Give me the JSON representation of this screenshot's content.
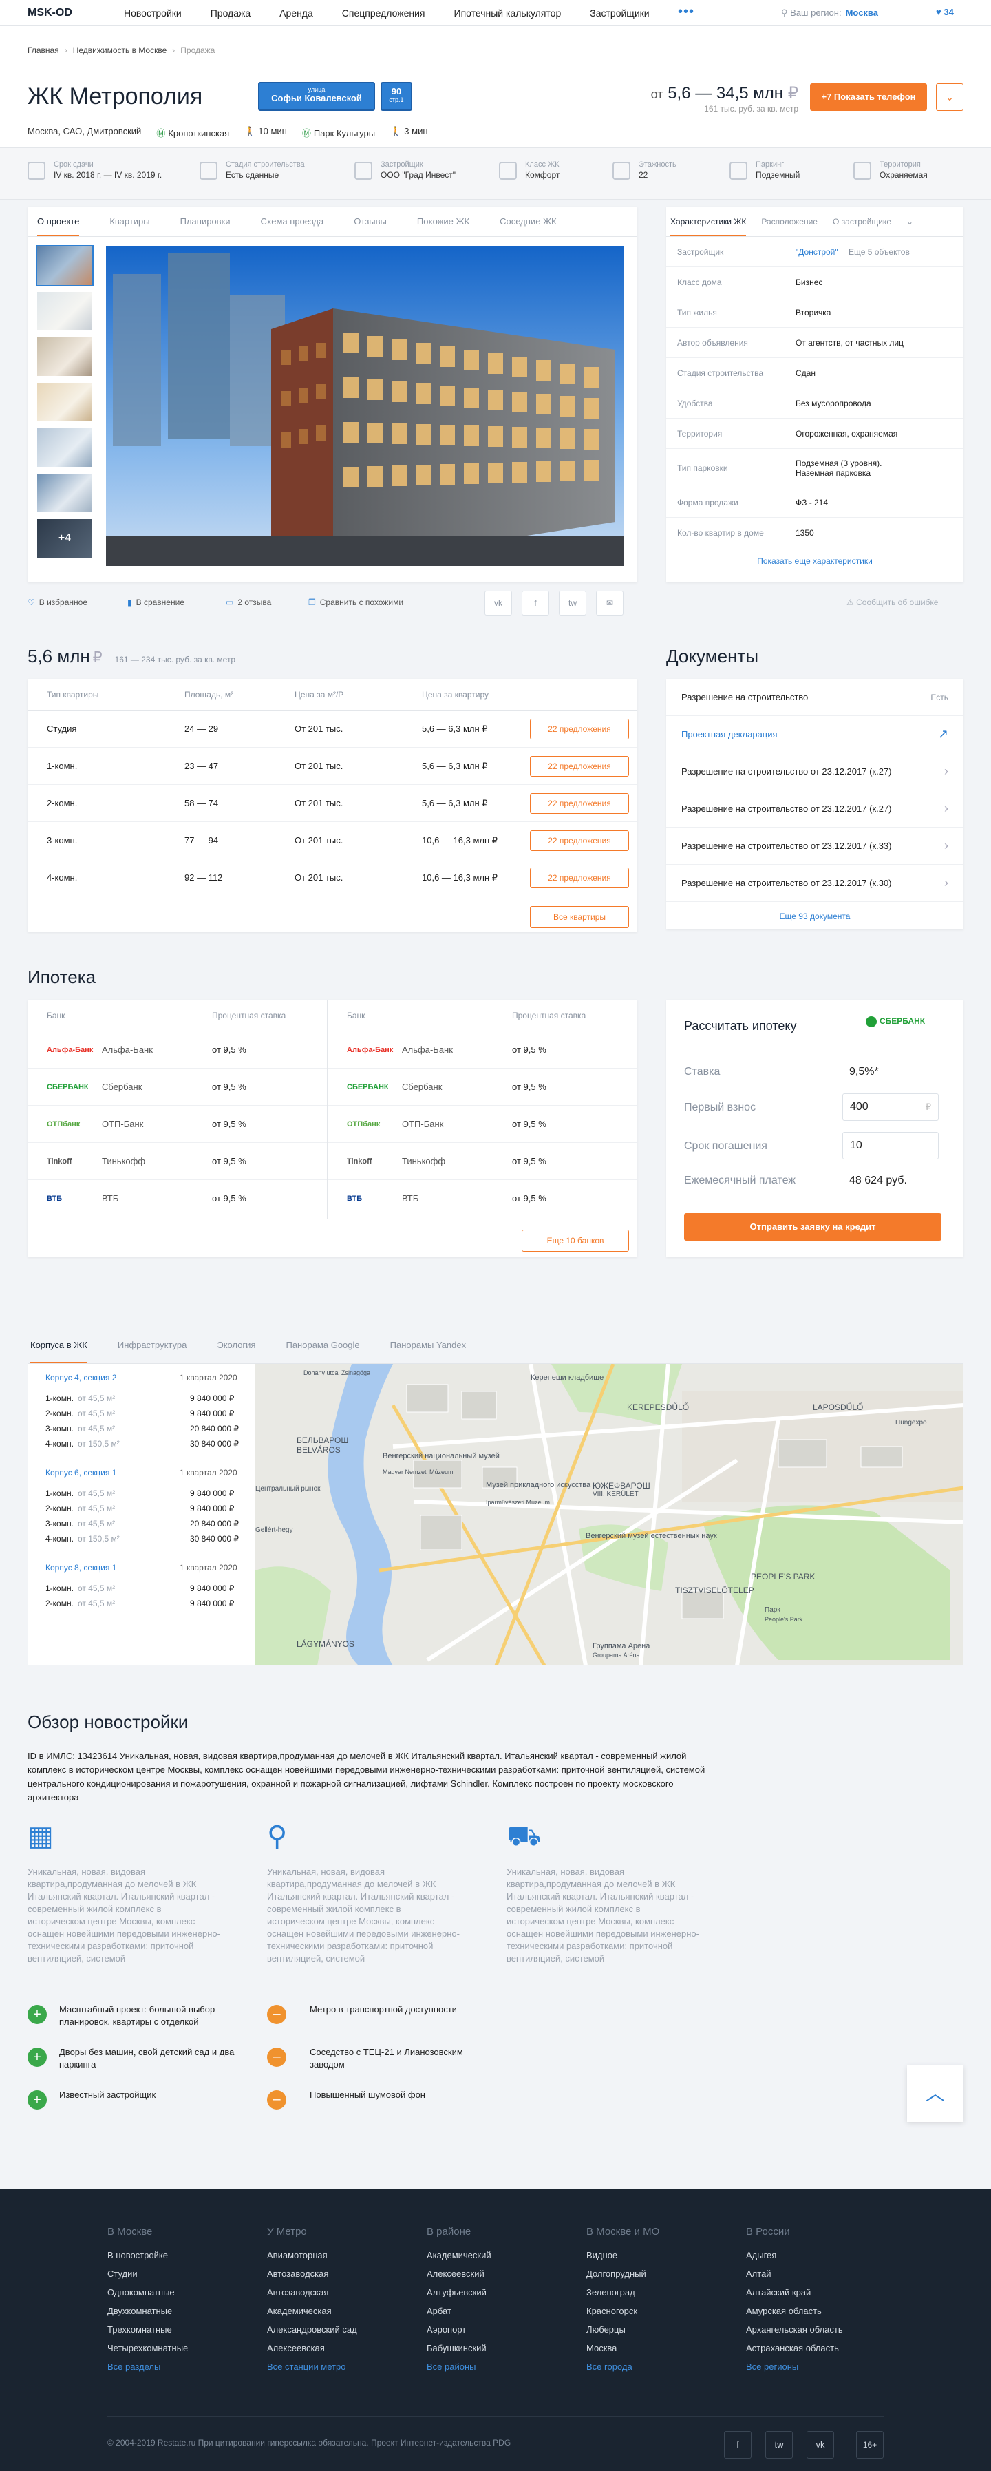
{
  "topbar": {
    "logo": "MSK-OD",
    "nav": [
      "Новостройки",
      "Продажа",
      "Аренда",
      "Спецпредложения",
      "Ипотечный калькулятор",
      "Застройщики"
    ],
    "more": "•••",
    "region_label": "Ваш регион:",
    "region_value": "Москва",
    "favorites_count": "34"
  },
  "breadcrumb": {
    "items": [
      "Главная",
      "Недвижимость в Москве",
      "Продажа"
    ]
  },
  "complex": {
    "title": "ЖК Метрополия",
    "street_label": "улица",
    "street_name": "Софьи Ковалевской",
    "house_number": "90",
    "house_building": "стр.1",
    "address": "Москва, САО, Дмитровский",
    "metro": [
      {
        "name": "Кропоткинская",
        "color": "#2b9a45"
      },
      {
        "name": "10 мин",
        "color": "#8a93a0"
      },
      {
        "name": "Парк Культуры",
        "color": "#2b9a45"
      },
      {
        "name": "3 мин",
        "color": "#8a93a0"
      }
    ],
    "price_prefix": "от",
    "price_range": "5,6 — 34,5 млн",
    "currency": "₽",
    "price_per_meter": "161 тыс. руб. за кв. метр",
    "show_phone_label": "+7 Показать телефон",
    "more_label": "⌄"
  },
  "specs": [
    {
      "label": "Срок сдачи",
      "value": "IV кв. 2018 г. — IV кв. 2019 г."
    },
    {
      "label": "Стадия строительства",
      "value": "Есть сданные"
    },
    {
      "label": "Застройщик",
      "value": "ООО \"Град Инвест\""
    },
    {
      "label": "Класс ЖК",
      "value": "Комфорт"
    },
    {
      "label": "Этажность",
      "value": "22"
    },
    {
      "label": "Паркинг",
      "value": "Подземный"
    },
    {
      "label": "Территория",
      "value": "Охраняемая"
    }
  ],
  "main_tabs": [
    "О проекте",
    "Квартиры",
    "Планировки",
    "Схема проезда",
    "Отзывы",
    "Похожие ЖК",
    "Соседние ЖК"
  ],
  "gallery": {
    "more_label": "+4"
  },
  "actions": {
    "favorite": "В избранное",
    "compare": "В сравнение",
    "reviews": "2 отзыва",
    "similar": "Сравнить с похожими",
    "social": [
      "vk",
      "f",
      "tw",
      "✉"
    ]
  },
  "characteristics": {
    "tabs": [
      "Характеристики ЖК",
      "Расположение",
      "О застройщике"
    ],
    "rows": [
      {
        "key": "Застройщик",
        "value": "\"Донстрой\"",
        "extra": "Еще 5 объектов"
      },
      {
        "key": "Класс дома",
        "value": "Бизнес"
      },
      {
        "key": "Тип жилья",
        "value": "Вторичка"
      },
      {
        "key": "Автор объявления",
        "value": "От агентств, от частных лиц"
      },
      {
        "key": "Стадия строительства",
        "value": "Сдан"
      },
      {
        "key": "Удобства",
        "value": "Без мусоропровода"
      },
      {
        "key": "Территория",
        "value": "Огороженная, охраняемая"
      },
      {
        "key": "Тип парковки",
        "value": "Подземная (3 уровня). Наземная парковка"
      },
      {
        "key": "Форма продажи",
        "value": "ФЗ - 214"
      },
      {
        "key": "Кол-во квартир в доме",
        "value": "1350"
      }
    ],
    "show_more": "Показать еще характеристики",
    "report_error": "Сообщить об ошибке"
  },
  "apartments": {
    "price": "5,6 млн",
    "currency": "₽",
    "price_note": "161 — 234 тыс. руб. за кв. метр",
    "headers": [
      "Тип квартиры",
      "Площадь, м²",
      "Цена за м²/Р",
      "Цена за квартиру"
    ],
    "rows": [
      {
        "type": "Студия",
        "area": "24 — 29",
        "ppm": "От 201 тыс.",
        "price": "5,6 — 6,3 млн ₽",
        "offers": "22 предложения"
      },
      {
        "type": "1-комн.",
        "area": "23 — 47",
        "ppm": "От 201 тыс.",
        "price": "5,6 — 6,3 млн ₽",
        "offers": "22 предложения"
      },
      {
        "type": "2-комн.",
        "area": "58 — 74",
        "ppm": "От 201 тыс.",
        "price": "5,6 — 6,3 млн ₽",
        "offers": "22 предложения"
      },
      {
        "type": "3-комн.",
        "area": "77 — 94",
        "ppm": "От 201 тыс.",
        "price": "10,6 — 16,3 млн ₽",
        "offers": "22 предложения"
      },
      {
        "type": "4-комн.",
        "area": "92 — 112",
        "ppm": "От 201 тыс.",
        "price": "10,6 — 16,3 млн ₽",
        "offers": "22 предложения"
      }
    ],
    "all_button": "Все квартиры"
  },
  "documents": {
    "title": "Документы",
    "rows": [
      {
        "name": "Разрешение на строительство",
        "status": "Есть",
        "link": false
      },
      {
        "name": "Проектная декларация",
        "status": "↗",
        "link": true
      },
      {
        "name": "Разрешение на строительство от 23.12.2017 (к.27)",
        "status": "›",
        "link": false
      },
      {
        "name": "Разрешение на строительство от 23.12.2017 (к.27)",
        "status": "›",
        "link": false
      },
      {
        "name": "Разрешение на строительство от 23.12.2017 (к.33)",
        "status": "›",
        "link": false
      },
      {
        "name": "Разрешение на строительство от 23.12.2017 (к.30)",
        "status": "›",
        "link": false
      }
    ],
    "more": "Еще 93 документа"
  },
  "mortgage": {
    "title": "Ипотека",
    "headers": [
      "Банк",
      "Процентная ставка"
    ],
    "banks_left": [
      {
        "logo": "Альфа-Банк",
        "logo_color": "#e8332a",
        "name": "Альфа-Банк",
        "rate": "от 9,5 %"
      },
      {
        "logo": "СБЕРБАНК",
        "logo_color": "#21a038",
        "name": "Сбербанк",
        "rate": "от 9,5 %"
      },
      {
        "logo": "ОТПбанк",
        "logo_color": "#57a843",
        "name": "ОТП-Банк",
        "rate": "от 9,5 %"
      },
      {
        "logo": "Tinkoff",
        "logo_color": "#555555",
        "name": "Тинькофф",
        "rate": "от 9,5 %"
      },
      {
        "logo": "ВТБ",
        "logo_color": "#0a3d91",
        "name": "ВТБ",
        "rate": "от 9,5 %"
      }
    ],
    "banks_right": [
      {
        "logo": "Альфа-Банк",
        "logo_color": "#e8332a",
        "name": "Альфа-Банк",
        "rate": "от 9,5 %"
      },
      {
        "logo": "СБЕРБАНК",
        "logo_color": "#21a038",
        "name": "Сбербанк",
        "rate": "от 9,5 %"
      },
      {
        "logo": "ОТПбанк",
        "logo_color": "#57a843",
        "name": "ОТП-Банк",
        "rate": "от 9,5 %"
      },
      {
        "logo": "Tinkoff",
        "logo_color": "#555555",
        "name": "Тинькофф",
        "rate": "от 9,5 %"
      },
      {
        "logo": "ВТБ",
        "logo_color": "#0a3d91",
        "name": "ВТБ",
        "rate": "от 9,5 %"
      }
    ],
    "more_banks": "Еще 10 банков"
  },
  "calculator": {
    "title": "Рассчитать ипотеку",
    "bank_logo": "СБЕРБАНК",
    "rate_label": "Ставка",
    "rate_value": "9,5%*",
    "down_label": "Первый взнос",
    "down_value": "400",
    "down_unit": "₽",
    "term_label": "Срок погашения",
    "term_value": "10",
    "monthly_label": "Ежемесячный платеж",
    "monthly_value": "48 624 руб.",
    "submit": "Отправить заявку на кредит"
  },
  "location": {
    "tabs": [
      "Корпуса в ЖК",
      "Инфраструктура",
      "Экология",
      "Панорама Google",
      "Панорамы Yandex"
    ],
    "buildings": [
      {
        "name": "Корпус 4, секция 2",
        "date": "1 квартал 2020",
        "rows": [
          {
            "type": "1-комн.",
            "area": "от 45,5 м²",
            "price": "9 840 000 ₽"
          },
          {
            "type": "2-комн.",
            "area": "от 45,5 м²",
            "price": "9 840 000 ₽"
          },
          {
            "type": "3-комн.",
            "area": "от 45,5 м²",
            "price": "20 840 000 ₽"
          },
          {
            "type": "4-комн.",
            "area": "от 150,5 м²",
            "price": "30 840 000 ₽"
          }
        ]
      },
      {
        "name": "Корпус 6, секция 1",
        "date": "1 квартал 2020",
        "rows": [
          {
            "type": "1-комн.",
            "area": "от 45,5 м²",
            "price": "9 840 000 ₽"
          },
          {
            "type": "2-комн.",
            "area": "от 45,5 м²",
            "price": "9 840 000 ₽"
          },
          {
            "type": "3-комн.",
            "area": "от 45,5 м²",
            "price": "20 840 000 ₽"
          },
          {
            "type": "4-комн.",
            "area": "от 150,5 м²",
            "price": "30 840 000 ₽"
          }
        ]
      },
      {
        "name": "Корпус 8, секция 1",
        "date": "1 квартал 2020",
        "rows": [
          {
            "type": "1-комн.",
            "area": "от 45,5 м²",
            "price": "9 840 000 ₽"
          },
          {
            "type": "2-комн.",
            "area": "от 45,5 м²",
            "price": "9 840 000 ₽"
          }
        ]
      }
    ],
    "map_labels": [
      {
        "text": "Dohány utcai Zsinagóga"
      },
      {
        "text": "Керепеши кладбище"
      },
      {
        "text": "KEREPESDŰLŐ"
      },
      {
        "text": "LAPOSDŰLŐ"
      },
      {
        "text": "Hungexpo"
      },
      {
        "text": "БЕЛЬВАРОШ"
      },
      {
        "text": "BELVÁROS"
      },
      {
        "text": "Венгерский национальный музей"
      },
      {
        "text": "Magyar Nemzeti Múzeum"
      },
      {
        "text": "Музей прикладного искусства"
      },
      {
        "text": "Iparművészeti Múzeum"
      },
      {
        "text": "ЮЖЕФВАРОШ"
      },
      {
        "text": "VIII. KERÜLET"
      },
      {
        "text": "Центральный рынок"
      },
      {
        "text": "Gellért-hegy"
      },
      {
        "text": "Венгерский музей естественных наук"
      },
      {
        "text": "PEOPLE'S PARK"
      },
      {
        "text": "Парк"
      },
      {
        "text": "People's Park"
      },
      {
        "text": "TISZTVISELŐTELEP"
      },
      {
        "text": "LÁGYMÁNYOS"
      },
      {
        "text": "Группама Арена"
      },
      {
        "text": "Groupama Aréna"
      }
    ]
  },
  "overview": {
    "title": "Обзор новостройки",
    "text": "ID в ИМЛС: 13423614 Уникальная, новая, видовая квартира,продуманная до мелочей в ЖК Итальянский квартал. Итальянский квартал - современный жилой комплекс в историческом центре Москвы, комплекс оснащен новейшими передовыми инженерно-техническими разработками: приточной вентиляцией, системой центрального кондиционирования и пожаротушения, охранной и пожарной сигнализацией, лифтами Schindler. Комплекс построен по проекту московского архитектора",
    "features": [
      {
        "icon": "building-icon",
        "text": "Уникальная, новая, видовая квартира,продуманная до мелочей в ЖК Итальянский квартал. Итальянский квартал - современный жилой комплекс в историческом центре Москвы, комплекс оснащен новейшими передовыми инженерно-техническими разработками: приточной вентиляцией, системой"
      },
      {
        "icon": "location-pin-icon",
        "text": "Уникальная, новая, видовая квартира,продуманная до мелочей в ЖК Итальянский квартал. Итальянский квартал - современный жилой комплекс в историческом центре Москвы, комплекс оснащен новейшими передовыми инженерно-техническими разработками: приточной вентиляцией, системой"
      },
      {
        "icon": "car-icon",
        "text": "Уникальная, новая, видовая квартира,продуманная до мелочей в ЖК Итальянский квартал. Итальянский квартал - современный жилой комплекс в историческом центре Москвы, комплекс оснащен новейшими передовыми инженерно-техническими разработками: приточной вентиляцией, системой"
      }
    ],
    "pros": [
      "Масштабный проект: большой выбор планировок, квартиры с отделкой",
      "Дворы без машин, свой детский сад и два паркинга",
      "Известный застройщик"
    ],
    "cons": [
      "Метро в транспортной доступности",
      "Соседство с ТЕЦ-21 и Лианозовским заводом",
      "Повышенный шумовой фон"
    ],
    "colors": {
      "pro": "#3aa84a",
      "con": "#f0922e"
    }
  },
  "footer": {
    "columns": [
      {
        "heading": "В Москве",
        "items": [
          "В новостройке",
          "Студии",
          "Однокомнатные",
          "Двухкомнатные",
          "Трехкомнатные",
          "Четырехкомнатные"
        ],
        "all": "Все разделы"
      },
      {
        "heading": "У Метро",
        "items": [
          "Авиамоторная",
          "Автозаводская",
          "Автозаводская",
          "Академическая",
          "Александровский сад",
          "Алексеевская"
        ],
        "all": "Все станции метро"
      },
      {
        "heading": "В районе",
        "items": [
          "Академический",
          "Алексеевский",
          "Алтуфьевский",
          "Арбат",
          "Аэропорт",
          "Бабушкинский"
        ],
        "all": "Все районы"
      },
      {
        "heading": "В Москве и МО",
        "items": [
          "Видное",
          "Долгопрудный",
          "Зеленоград",
          "Красногорск",
          "Люберцы",
          "Москва"
        ],
        "all": "Все города"
      },
      {
        "heading": "В России",
        "items": [
          "Адыгея",
          "Алтай",
          "Алтайский край",
          "Амурская область",
          "Архангельская область",
          "Астраханская область"
        ],
        "all": "Все регионы"
      }
    ],
    "copyright": "© 2004-2019 Restate.ru При цитировании гиперссылка обязательна. Проект Интернет-издательства PDG",
    "social": [
      "f",
      "tw",
      "vk",
      "16+"
    ]
  },
  "colors": {
    "accent": "#f47a2a",
    "link": "#2d7fd3",
    "footer_bg": "#1a2430"
  }
}
